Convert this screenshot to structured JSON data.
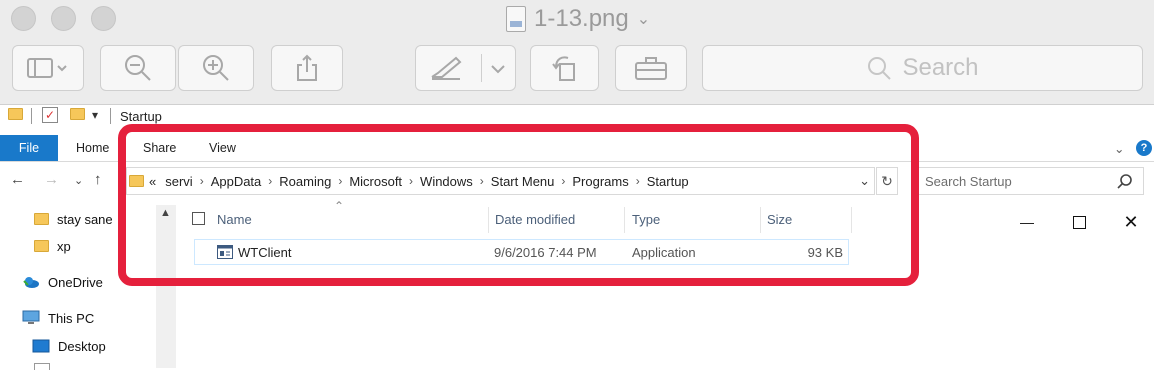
{
  "mac_window": {
    "title": "1-13.png",
    "search_placeholder": "Search"
  },
  "explorer": {
    "title": "Startup",
    "ribbon_tabs": [
      "File",
      "Home",
      "Share",
      "View"
    ],
    "breadcrumb_prefix": "«",
    "breadcrumbs": [
      "servi",
      "AppData",
      "Roaming",
      "Microsoft",
      "Windows",
      "Start Menu",
      "Programs",
      "Startup"
    ],
    "search_placeholder": "Search Startup",
    "nav_items": [
      "stay sane",
      "xp",
      "OneDrive",
      "This PC",
      "Desktop"
    ],
    "columns": {
      "name": "Name",
      "date": "Date modified",
      "type": "Type",
      "size": "Size"
    },
    "files": [
      {
        "name": "WTClient",
        "date": "9/6/2016 7:44 PM",
        "type": "Application",
        "size": "93 KB"
      }
    ]
  },
  "colors": {
    "annotation_red": "#e5203c",
    "file_tab_blue": "#1979ca"
  }
}
